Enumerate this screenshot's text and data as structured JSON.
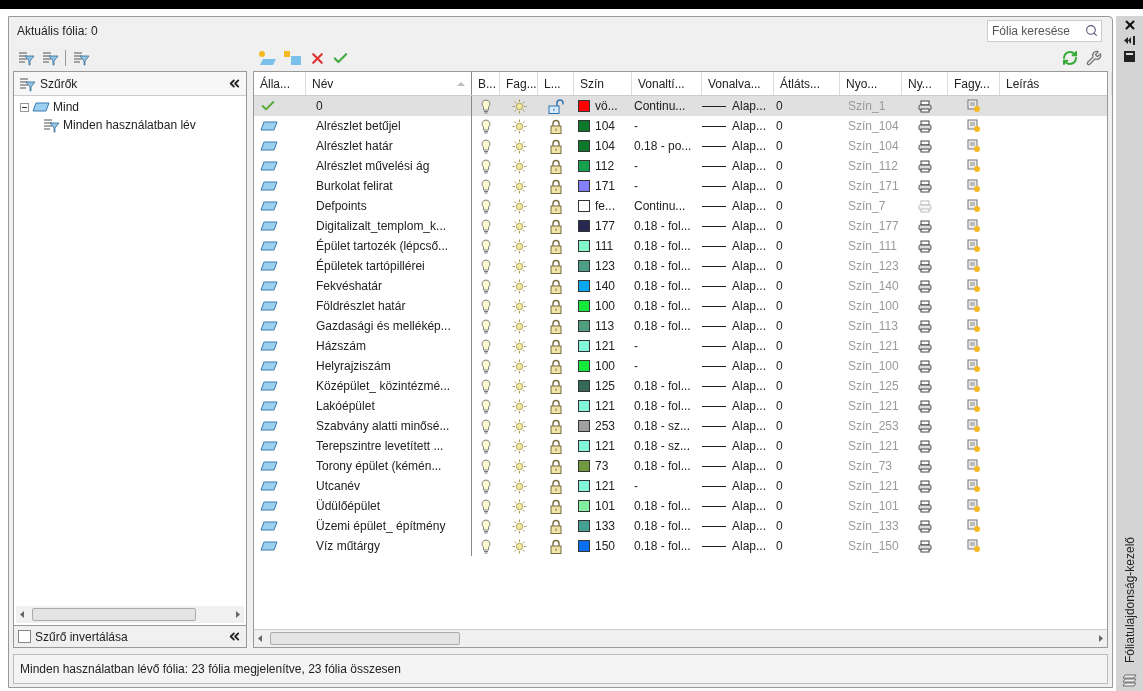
{
  "current_layer": "Aktuális fólia: 0",
  "search": {
    "placeholder": "Fólia keresése"
  },
  "filters": {
    "title": "Szűrők",
    "tree": [
      {
        "label": "Mind",
        "expanded": true,
        "children": [
          {
            "label": "Minden használatban lév"
          }
        ]
      }
    ],
    "invert": {
      "label": "Szűrő invertálása",
      "checked": false
    }
  },
  "columns": [
    {
      "label": "Álla...",
      "sorted": false
    },
    {
      "label": "Név",
      "sorted": true
    },
    {
      "label": "B...",
      "sorted": false
    },
    {
      "label": "Fag...",
      "sorted": false
    },
    {
      "label": "L...",
      "sorted": false
    },
    {
      "label": "Szín",
      "sorted": false
    },
    {
      "label": "Vonaltí...",
      "sorted": false
    },
    {
      "label": "Vonalva...",
      "sorted": false
    },
    {
      "label": "Átláts...",
      "sorted": false
    },
    {
      "label": "Nyo...",
      "sorted": false
    },
    {
      "label": "Ny...",
      "sorted": false
    },
    {
      "label": "Fagy...",
      "sorted": false
    },
    {
      "label": "Leírás",
      "sorted": false
    }
  ],
  "rows": [
    {
      "current": true,
      "selected": true,
      "name": "0",
      "locked": false,
      "color": "#ff0000",
      "color_label": "vö...",
      "linetype": "Continu...",
      "lineweight": "Alap...",
      "transparency": "0",
      "plot_style": "Szín_1",
      "plot": true
    },
    {
      "current": false,
      "selected": false,
      "name": "Alrészlet betűjel",
      "locked": true,
      "color": "#0b7a2b",
      "color_label": "104",
      "linetype": "-",
      "lineweight": "Alap...",
      "transparency": "0",
      "plot_style": "Szín_104",
      "plot": true
    },
    {
      "current": false,
      "selected": false,
      "name": "Alrészlet határ",
      "locked": true,
      "color": "#0b7a2b",
      "color_label": "104",
      "linetype": "0.18 - po...",
      "lineweight": "Alap...",
      "transparency": "0",
      "plot_style": "Szín_104",
      "plot": true
    },
    {
      "current": false,
      "selected": false,
      "name": "Alrészlet művelési ág",
      "locked": true,
      "color": "#15a150",
      "color_label": "112",
      "linetype": "-",
      "lineweight": "Alap...",
      "transparency": "0",
      "plot_style": "Szín_112",
      "plot": true
    },
    {
      "current": false,
      "selected": false,
      "name": "Burkolat felirat",
      "locked": true,
      "color": "#8080ff",
      "color_label": "171",
      "linetype": "-",
      "lineweight": "Alap...",
      "transparency": "0",
      "plot_style": "Szín_171",
      "plot": true
    },
    {
      "current": false,
      "selected": false,
      "name": "Defpoints",
      "locked": true,
      "color": "#ffffff",
      "color_label": "fe...",
      "linetype": "Continu...",
      "lineweight": "Alap...",
      "transparency": "0",
      "plot_style": "Szín_7",
      "plot": false
    },
    {
      "current": false,
      "selected": false,
      "name": "Digitalizalt_templom_k...",
      "locked": true,
      "color": "#26284f",
      "color_label": "177",
      "linetype": "0.18 - fol...",
      "lineweight": "Alap...",
      "transparency": "0",
      "plot_style": "Szín_177",
      "plot": true
    },
    {
      "current": false,
      "selected": false,
      "name": "Épület tartozék (lépcső...",
      "locked": true,
      "color": "#80f8c8",
      "color_label": "111",
      "linetype": "0.18 - fol...",
      "lineweight": "Alap...",
      "transparency": "0",
      "plot_style": "Szín_111",
      "plot": true
    },
    {
      "current": false,
      "selected": false,
      "name": "Épületek tartópillérei",
      "locked": true,
      "color": "#4c9f86",
      "color_label": "123",
      "linetype": "0.18 - fol...",
      "lineweight": "Alap...",
      "transparency": "0",
      "plot_style": "Szín_123",
      "plot": true
    },
    {
      "current": false,
      "selected": false,
      "name": "Fekvéshatár",
      "locked": true,
      "color": "#0aa6f0",
      "color_label": "140",
      "linetype": "0.18 - fol...",
      "lineweight": "Alap...",
      "transparency": "0",
      "plot_style": "Szín_140",
      "plot": true
    },
    {
      "current": false,
      "selected": false,
      "name": "Földrészlet határ",
      "locked": true,
      "color": "#17e83c",
      "color_label": "100",
      "linetype": "0.18 - fol...",
      "lineweight": "Alap...",
      "transparency": "0",
      "plot_style": "Szín_100",
      "plot": true
    },
    {
      "current": false,
      "selected": false,
      "name": "Gazdasági és mellékép...",
      "locked": true,
      "color": "#4f9f7f",
      "color_label": "113",
      "linetype": "0.18 - fol...",
      "lineweight": "Alap...",
      "transparency": "0",
      "plot_style": "Szín_113",
      "plot": true
    },
    {
      "current": false,
      "selected": false,
      "name": "Házszám",
      "locked": true,
      "color": "#80f5d8",
      "color_label": "121",
      "linetype": "-",
      "lineweight": "Alap...",
      "transparency": "0",
      "plot_style": "Szín_121",
      "plot": true
    },
    {
      "current": false,
      "selected": false,
      "name": "Helyrajziszám",
      "locked": true,
      "color": "#17e83c",
      "color_label": "100",
      "linetype": "-",
      "lineweight": "Alap...",
      "transparency": "0",
      "plot_style": "Szín_100",
      "plot": true
    },
    {
      "current": false,
      "selected": false,
      "name": "Középület_ közintézmé...",
      "locked": true,
      "color": "#356a58",
      "color_label": "125",
      "linetype": "0.18 - fol...",
      "lineweight": "Alap...",
      "transparency": "0",
      "plot_style": "Szín_125",
      "plot": true
    },
    {
      "current": false,
      "selected": false,
      "name": "Lakóépület",
      "locked": true,
      "color": "#80f5d8",
      "color_label": "121",
      "linetype": "0.18 - fol...",
      "lineweight": "Alap...",
      "transparency": "0",
      "plot_style": "Szín_121",
      "plot": true
    },
    {
      "current": false,
      "selected": false,
      "name": "Szabvány alatti minősé...",
      "locked": true,
      "color": "#a0a0a0",
      "color_label": "253",
      "linetype": "0.18 - sz...",
      "lineweight": "Alap...",
      "transparency": "0",
      "plot_style": "Szín_253",
      "plot": true
    },
    {
      "current": false,
      "selected": false,
      "name": "Terepszintre levetített ...",
      "locked": true,
      "color": "#80f5d8",
      "color_label": "121",
      "linetype": "0.18 - sz...",
      "lineweight": "Alap...",
      "transparency": "0",
      "plot_style": "Szín_121",
      "plot": true
    },
    {
      "current": false,
      "selected": false,
      "name": "Torony épület (kémén...",
      "locked": true,
      "color": "#739a40",
      "color_label": "73",
      "linetype": "0.18 - fol...",
      "lineweight": "Alap...",
      "transparency": "0",
      "plot_style": "Szín_73",
      "plot": true
    },
    {
      "current": false,
      "selected": false,
      "name": "Utcanév",
      "locked": true,
      "color": "#80f5d8",
      "color_label": "121",
      "linetype": "-",
      "lineweight": "Alap...",
      "transparency": "0",
      "plot_style": "Szín_121",
      "plot": true
    },
    {
      "current": false,
      "selected": false,
      "name": "Üdülőépület",
      "locked": true,
      "color": "#80f0a0",
      "color_label": "101",
      "linetype": "0.18 - fol...",
      "lineweight": "Alap...",
      "transparency": "0",
      "plot_style": "Szín_101",
      "plot": true
    },
    {
      "current": false,
      "selected": false,
      "name": "Üzemi épület_ építmény",
      "locked": true,
      "color": "#45a095",
      "color_label": "133",
      "linetype": "0.18 - fol...",
      "lineweight": "Alap...",
      "transparency": "0",
      "plot_style": "Szín_133",
      "plot": true
    },
    {
      "current": false,
      "selected": false,
      "name": "Víz műtárgy",
      "locked": true,
      "color": "#0a6ef0",
      "color_label": "150",
      "linetype": "0.18 - fol...",
      "lineweight": "Alap...",
      "transparency": "0",
      "plot_style": "Szín_150",
      "plot": true
    }
  ],
  "status_bar": "Minden használatban lévő fólia: 23 fólia megjelenítve, 23 fólia összesen",
  "side_title": "Fóliatulajdonság-kezelő"
}
